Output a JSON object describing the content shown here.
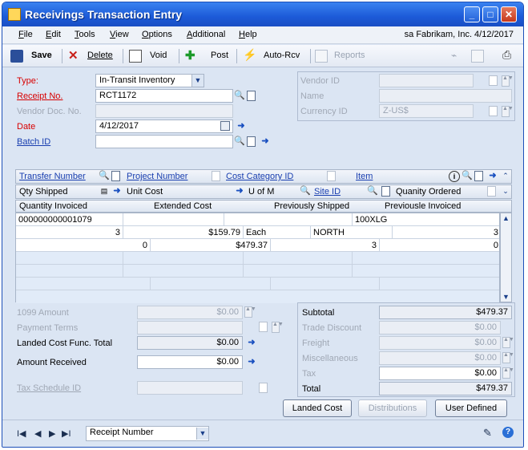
{
  "window": {
    "title": "Receivings Transaction Entry"
  },
  "menu": [
    "File",
    "Edit",
    "Tools",
    "View",
    "Options",
    "Additional",
    "Help"
  ],
  "context": "sa  Fabrikam, Inc.  4/12/2017",
  "toolbar": {
    "save": "Save",
    "delete": "Delete",
    "void": "Void",
    "post": "Post",
    "auto_rcv": "Auto-Rcv",
    "reports": "Reports"
  },
  "header": {
    "type_label": "Type:",
    "type_value": "In-Transit Inventory",
    "receipt_label": "Receipt No.",
    "receipt_value": "RCT1172",
    "vendor_doc_label": "Vendor Doc. No.",
    "date_label": "Date",
    "date_value": "4/12/2017",
    "batch_label": "Batch ID",
    "vendor_id_label": "Vendor ID",
    "name_label": "Name",
    "currency_label": "Currency ID",
    "currency_value": "Z-US$"
  },
  "grid": {
    "head1": {
      "transfer": "Transfer Number",
      "project": "Project Number",
      "cost_category": "Cost Category ID",
      "item": "Item"
    },
    "head2": {
      "qty_shipped": "Qty Shipped",
      "unit_cost": "Unit Cost",
      "uofm": "U of M",
      "site": "Site ID",
      "qty_ordered": "Quanity Ordered"
    },
    "head3": {
      "qty_invoiced": "Quantity Invoiced",
      "extended_cost": "Extended Cost",
      "prev_shipped": "Previously Shipped",
      "prev_invoiced": "Previousle Invoiced"
    },
    "row1": {
      "transfer": "000000000001079",
      "item": "100XLG"
    },
    "row2": {
      "qty_shipped": "3",
      "unit_cost": "$159.79",
      "uofm": "Each",
      "site": "NORTH",
      "qty_ordered": "3"
    },
    "row3": {
      "qty_invoiced": "0",
      "extended_cost": "$479.37",
      "prev_shipped": "3",
      "prev_invoiced": "0"
    }
  },
  "totals": {
    "amount_1099_label": "1099 Amount",
    "amount_1099": "$0.00",
    "payment_terms_label": "Payment Terms",
    "landed_cost_label": "Landed Cost Func. Total",
    "landed_cost": "$0.00",
    "amount_received_label": "Amount Received",
    "amount_received": "$0.00",
    "tax_schedule_label": "Tax Schedule ID",
    "subtotal_label": "Subtotal",
    "subtotal": "$479.37",
    "trade_discount_label": "Trade Discount",
    "trade_discount": "$0.00",
    "freight_label": "Freight",
    "freight": "$0.00",
    "misc_label": "Miscellaneous",
    "misc": "$0.00",
    "tax_label": "Tax",
    "tax": "$0.00",
    "total_label": "Total",
    "total": "$479.37"
  },
  "buttons": {
    "landed_cost": "Landed Cost",
    "distributions": "Distributions",
    "user_defined": "User Defined"
  },
  "footer": {
    "sort_value": "Receipt Number"
  }
}
